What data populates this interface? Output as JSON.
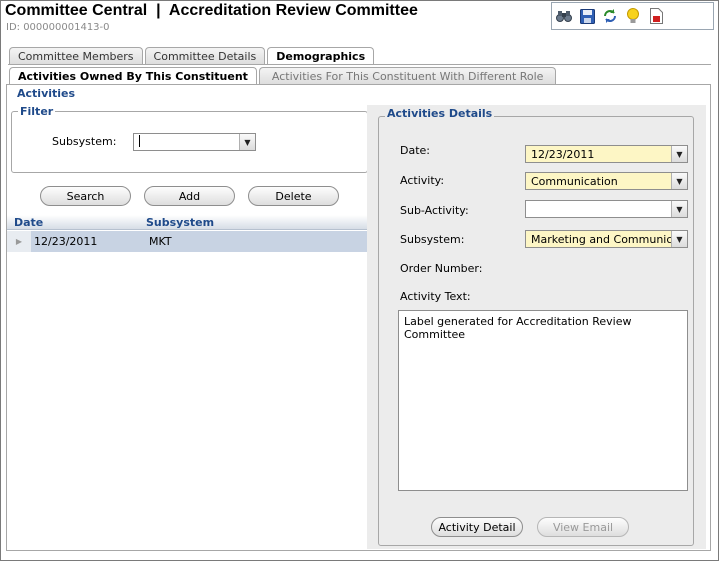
{
  "header": {
    "title": "Committee Central  |  Accreditation Review Committee",
    "id_text": "ID: 000000001413-0"
  },
  "toolbar": {
    "icons": [
      "binoculars-icon",
      "save-icon",
      "refresh-icon",
      "lightbulb-icon",
      "report-icon"
    ]
  },
  "tabs": {
    "primary": [
      "Committee Members",
      "Committee Details",
      "Demographics"
    ],
    "secondary": [
      "Activities Owned By This Constituent",
      "Activities For This Constituent With Different Role"
    ]
  },
  "activities": {
    "legend": "Activities",
    "filter": {
      "legend": "Filter",
      "subsystem_label": "Subsystem:",
      "subsystem_value": ""
    },
    "buttons": {
      "search": "Search",
      "add": "Add",
      "delete": "Delete"
    },
    "grid": {
      "columns": [
        "Date",
        "Subsystem"
      ],
      "rows": [
        {
          "date": "12/23/2011",
          "subsystem": "MKT"
        }
      ]
    }
  },
  "details": {
    "legend": "Activities Details",
    "date_label": "Date:",
    "date_value": "12/23/2011",
    "activity_label": "Activity:",
    "activity_value": "Communication",
    "subactivity_label": "Sub-Activity:",
    "subactivity_value": "",
    "subsystem_label": "Subsystem:",
    "subsystem_value": "Marketing and Communications",
    "order_label": "Order Number:",
    "text_label": "Activity Text:",
    "text_value": "Label generated for Accreditation Review Committee",
    "activity_detail_button": "Activity Detail",
    "view_email_button": "View Email"
  },
  "colors": {
    "accent": "#1f4a8a",
    "required_field": "#fdf6c5",
    "selected_row": "#c8d3e3"
  }
}
